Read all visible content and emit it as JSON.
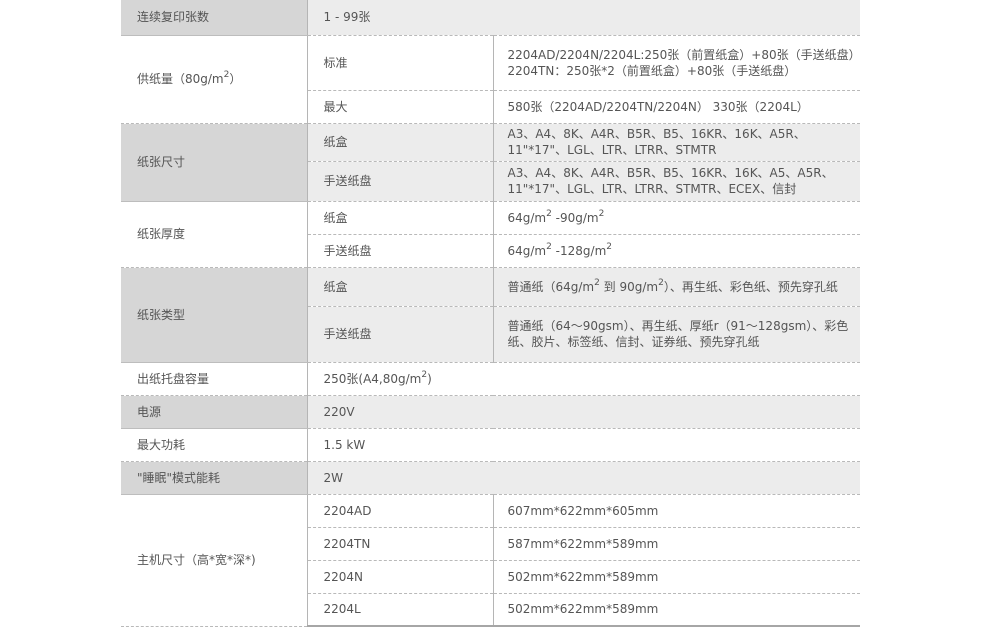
{
  "rows": {
    "copies": {
      "label": "连续复印张数",
      "value": "1 - 99张"
    },
    "paper_capacity": {
      "label_pre": "供纸量（80g/m",
      "label_sup": "2",
      "label_post": "）",
      "standard": {
        "label": "标准",
        "line1": "2204AD/2204N/2204L:250张（前置纸盒）+80张（手送纸盘）",
        "line2": "2204TN：250张*2（前置纸盒）+80张（手送纸盘）"
      },
      "max": {
        "label": "最大",
        "value": "580张（2204AD/2204TN/2204N） 330张（2204L）"
      }
    },
    "paper_size": {
      "label": "纸张尺寸",
      "cassette": {
        "label": "纸盒",
        "value": "A3、A4、8K、A4R、B5R、B5、16KR、16K、A5R、11\"*17\"、LGL、LTR、LTRR、STMTR"
      },
      "bypass": {
        "label": "手送纸盘",
        "value": "A3、A4、8K、A4R、B5R、B5、16KR、16K、A5、A5R、11\"*17\"、LGL、LTR、LTRR、STMTR、ECEX、信封"
      }
    },
    "paper_weight": {
      "label": "纸张厚度",
      "cassette": {
        "label": "纸盒",
        "pre": "64g/m",
        "sup1": "2",
        "mid": " -90g/m",
        "sup2": "2"
      },
      "bypass": {
        "label": "手送纸盘",
        "pre": "64g/m",
        "sup1": "2",
        "mid": " -128g/m",
        "sup2": "2"
      }
    },
    "paper_type": {
      "label": "纸张类型",
      "cassette": {
        "label": "纸盒",
        "pre": "普通纸（64g/m",
        "sup1": "2",
        "mid": " 到 90g/m",
        "sup2": "2",
        "post": "）、再生纸、彩色纸、预先穿孔纸"
      },
      "bypass": {
        "label": "手送纸盘",
        "value": "普通纸（64～90gsm）、再生纸、厚纸r（91～128gsm）、彩色纸、胶片、标签纸、信封、证券纸、预先穿孔纸"
      }
    },
    "output_tray": {
      "label": "出纸托盘容量",
      "pre": "250张(A4,80g/m",
      "sup": "2",
      "post": ")"
    },
    "power": {
      "label": "电源",
      "value": "220V"
    },
    "max_power": {
      "label": "最大功耗",
      "value": "1.5 kW"
    },
    "sleep_power": {
      "label": "\"睡眠\"模式能耗",
      "value": "2W"
    },
    "dimensions": {
      "label": "主机尺寸（高*宽*深*)",
      "models": [
        {
          "model": "2204AD",
          "value": "607mm*622mm*605mm"
        },
        {
          "model": "2204TN",
          "value": "587mm*622mm*589mm"
        },
        {
          "model": "2204N",
          "value": "502mm*622mm*589mm"
        },
        {
          "model": "2204L",
          "value": "502mm*622mm*589mm"
        }
      ]
    }
  }
}
